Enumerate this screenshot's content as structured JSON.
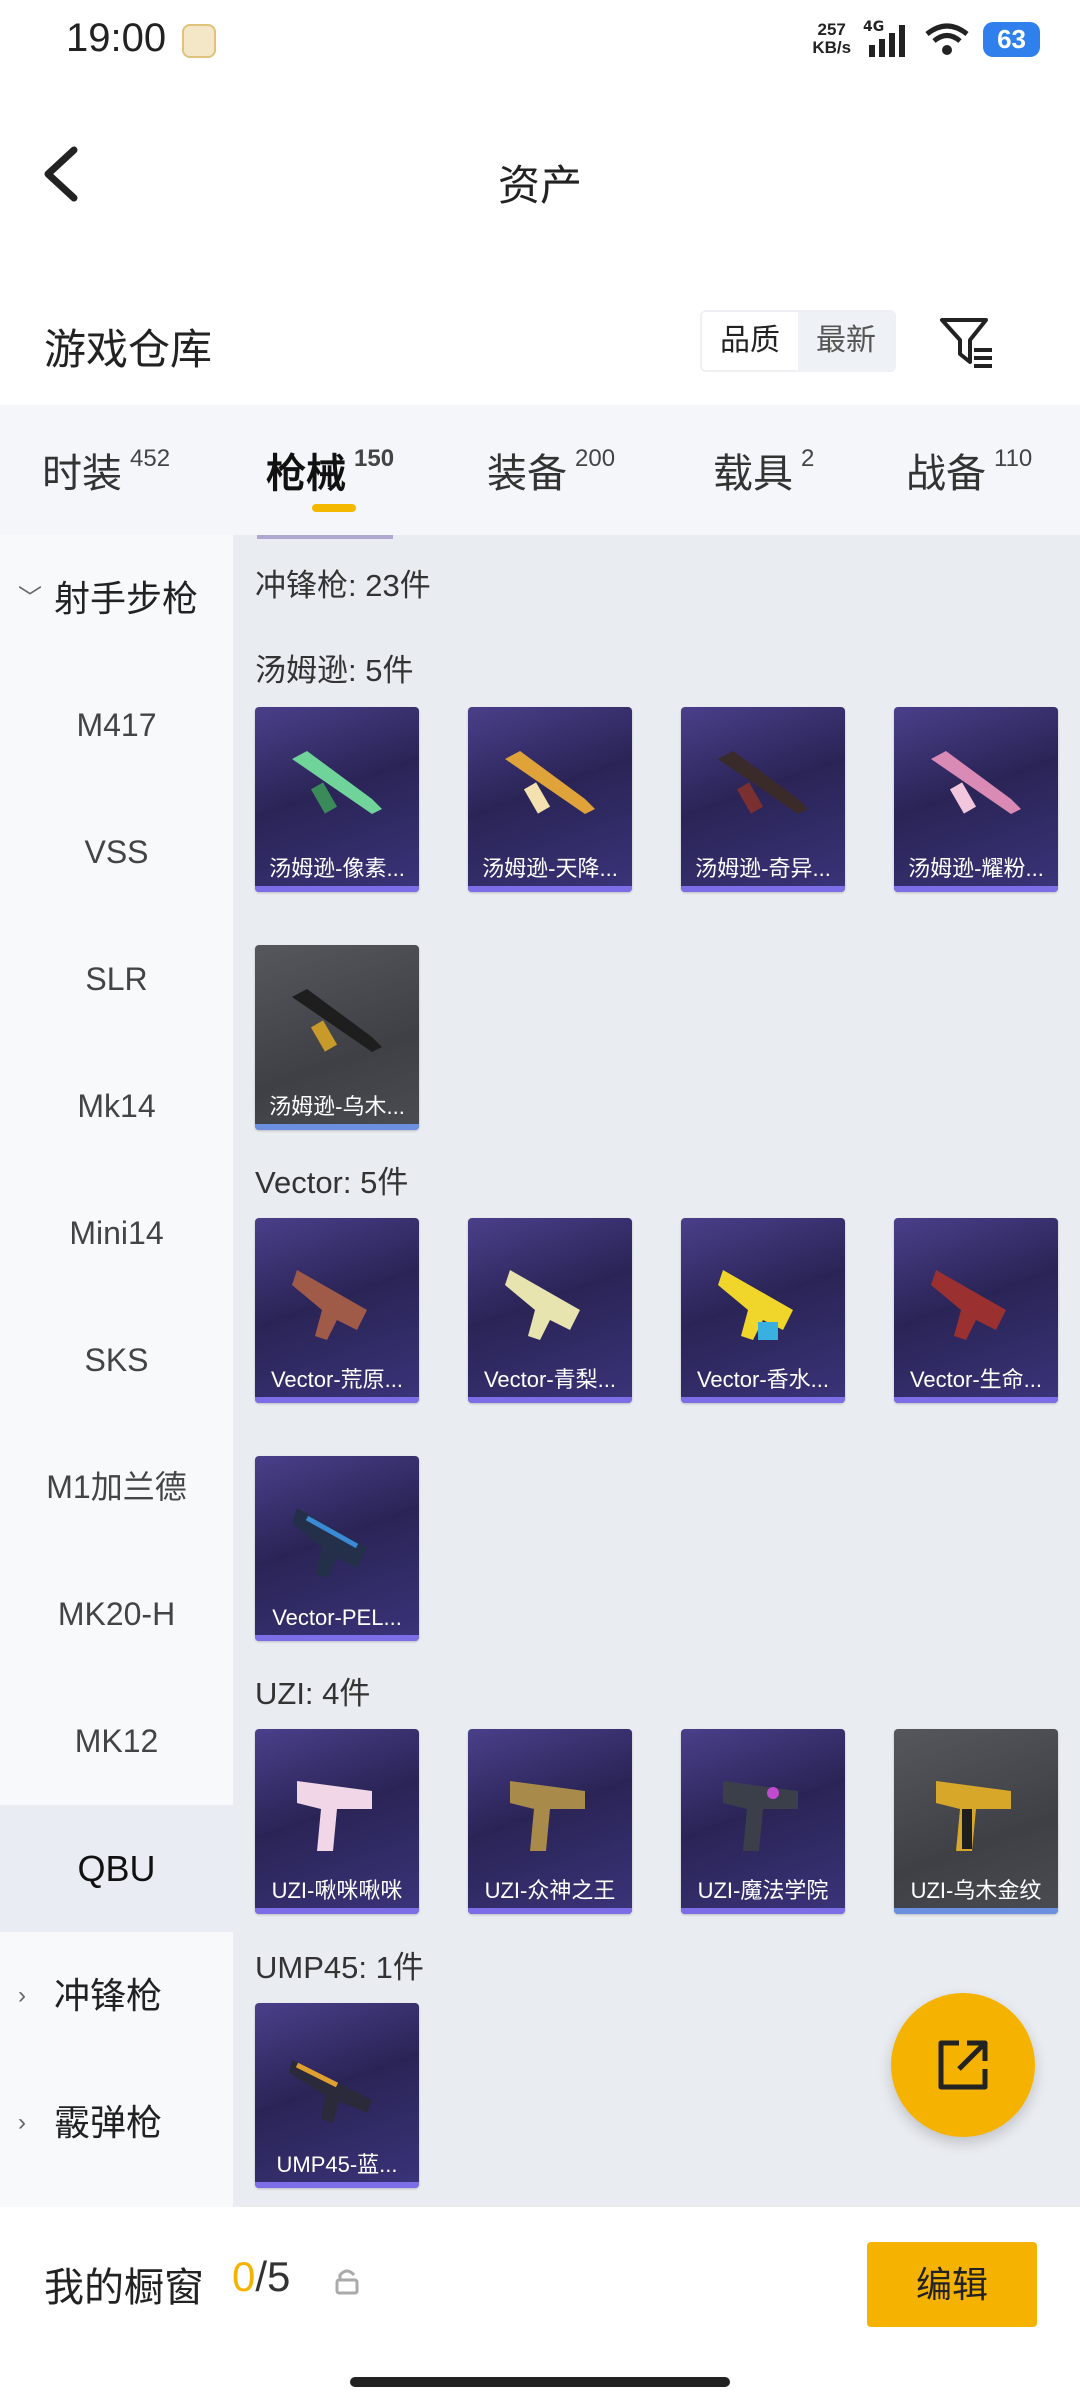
{
  "status_bar": {
    "time": "19:00",
    "speed": "257",
    "speed_unit": "KB/s",
    "network": "4G",
    "battery": "63"
  },
  "header": {
    "title": "资产"
  },
  "section": {
    "title": "游戏仓库",
    "sort_options": [
      "品质",
      "最新"
    ]
  },
  "categories": [
    {
      "label": "时装",
      "count": "452"
    },
    {
      "label": "枪械",
      "count": "150"
    },
    {
      "label": "装备",
      "count": "200"
    },
    {
      "label": "载具",
      "count": "2"
    },
    {
      "label": "战备",
      "count": "110"
    }
  ],
  "sidebar": {
    "group_open": "射手步枪",
    "items": [
      "M417",
      "VSS",
      "SLR",
      "Mk14",
      "Mini14",
      "SKS",
      "M1加兰德",
      "MK20-H",
      "MK12",
      "QBU"
    ],
    "groups_closed": [
      "冲锋枪",
      "霰弹枪"
    ]
  },
  "content": {
    "category_header": "冲锋枪: 23件",
    "groups": [
      {
        "label": "汤姆逊: 5件",
        "items": [
          "汤姆逊-像素...",
          "汤姆逊-天降...",
          "汤姆逊-奇异...",
          "汤姆逊-耀粉...",
          "汤姆逊-乌木..."
        ]
      },
      {
        "label": "Vector: 5件",
        "items": [
          "Vector-荒原...",
          "Vector-青梨...",
          "Vector-香水...",
          "Vector-生命...",
          "Vector-PEL..."
        ]
      },
      {
        "label": "UZI: 4件",
        "items": [
          "UZI-啾咪啾咪",
          "UZI-众神之王",
          "UZI-魔法学院",
          "UZI-乌木金纹"
        ]
      },
      {
        "label": "UMP45: 1件",
        "items": [
          "UMP45-蓝..."
        ]
      }
    ]
  },
  "bottom_bar": {
    "label": "我的橱窗",
    "current": "0",
    "total": "/5",
    "edit_label": "编辑"
  },
  "colors": {
    "accent": "#f5b300",
    "card_purple": "#2a2456",
    "card_grey": "#3e4046"
  },
  "icons": {
    "back": "back-arrow-icon",
    "filter": "filter-icon",
    "share": "share-external-icon",
    "lock": "lock-icon"
  }
}
